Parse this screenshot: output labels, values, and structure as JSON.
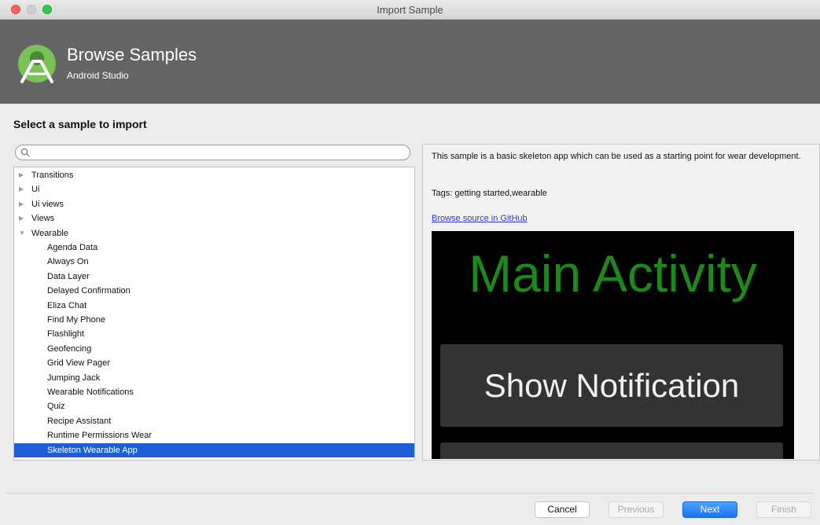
{
  "window": {
    "title": "Import Sample"
  },
  "header": {
    "title": "Browse Samples",
    "subtitle": "Android Studio",
    "logo_icon": "android-studio-logo"
  },
  "section_heading": "Select a sample to import",
  "search": {
    "value": "",
    "placeholder": ""
  },
  "tree": {
    "items": [
      {
        "label": "Transitions",
        "type": "collapsed"
      },
      {
        "label": "Ui",
        "type": "collapsed"
      },
      {
        "label": "Ui views",
        "type": "collapsed"
      },
      {
        "label": "Views",
        "type": "collapsed"
      },
      {
        "label": "Wearable",
        "type": "expanded"
      },
      {
        "label": "Agenda Data",
        "type": "child"
      },
      {
        "label": "Always On",
        "type": "child"
      },
      {
        "label": "Data Layer",
        "type": "child"
      },
      {
        "label": "Delayed Confirmation",
        "type": "child"
      },
      {
        "label": "Eliza Chat",
        "type": "child"
      },
      {
        "label": "Find My Phone",
        "type": "child"
      },
      {
        "label": "Flashlight",
        "type": "child"
      },
      {
        "label": "Geofencing",
        "type": "child"
      },
      {
        "label": "Grid View Pager",
        "type": "child"
      },
      {
        "label": "Jumping Jack",
        "type": "child"
      },
      {
        "label": "Wearable Notifications",
        "type": "child"
      },
      {
        "label": "Quiz",
        "type": "child"
      },
      {
        "label": "Recipe Assistant",
        "type": "child"
      },
      {
        "label": "Runtime Permissions Wear",
        "type": "child"
      },
      {
        "label": "Skeleton Wearable App",
        "type": "child",
        "selected": true
      }
    ]
  },
  "detail": {
    "description": "This sample is a basic skeleton app which can be used as a starting point for wear development.",
    "tags": "Tags: getting started,wearable",
    "link": "Browse source in GitHub",
    "preview": {
      "title": "Main Activity",
      "button": "Show Notification"
    }
  },
  "footer": {
    "cancel": "Cancel",
    "previous": "Previous",
    "next": "Next",
    "finish": "Finish"
  },
  "colors": {
    "accent": "#1d5fd6",
    "banner": "#646464",
    "preview_text": "#1b8a1b"
  }
}
